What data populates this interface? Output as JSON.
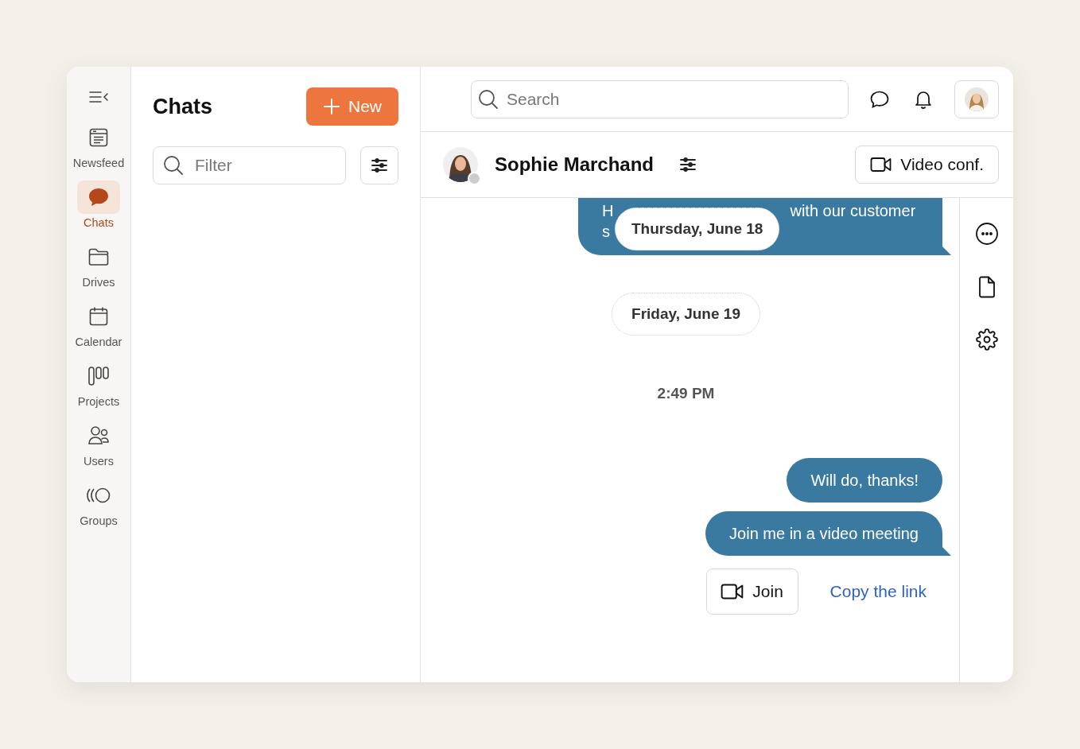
{
  "nav": [
    {
      "label": "Newsfeed",
      "selected": false
    },
    {
      "label": "Chats",
      "selected": true
    },
    {
      "label": "Drives",
      "selected": false
    },
    {
      "label": "Calendar",
      "selected": false
    },
    {
      "label": "Projects",
      "selected": false
    },
    {
      "label": "Users",
      "selected": false
    },
    {
      "label": "Groups",
      "selected": false
    }
  ],
  "chat_list": {
    "title": "Chats",
    "new_button": "New",
    "filter": {
      "placeholder": "Filter"
    }
  },
  "top_bar": {
    "search": {
      "placeholder": "Search"
    }
  },
  "conversation": {
    "contact": {
      "name": "Sophie Marchand",
      "online": false
    },
    "video_button": "Video conf.",
    "sticky_date": "Thursday, June 18",
    "messages": [
      {
        "kind": "partial",
        "line_1_start": "H",
        "line_1_end": "with our customer",
        "line_2_start": "s",
        "tail": true
      },
      {
        "kind": "date",
        "text": "Friday, June 19"
      },
      {
        "kind": "time",
        "text": "2:49 PM"
      },
      {
        "kind": "bubble",
        "text": "Will do, thanks!",
        "tail": false
      },
      {
        "kind": "bubble",
        "text": "Join me in a video meeting",
        "tail": true
      },
      {
        "kind": "actions",
        "join": "Join",
        "link": "Copy the link"
      }
    ]
  }
}
